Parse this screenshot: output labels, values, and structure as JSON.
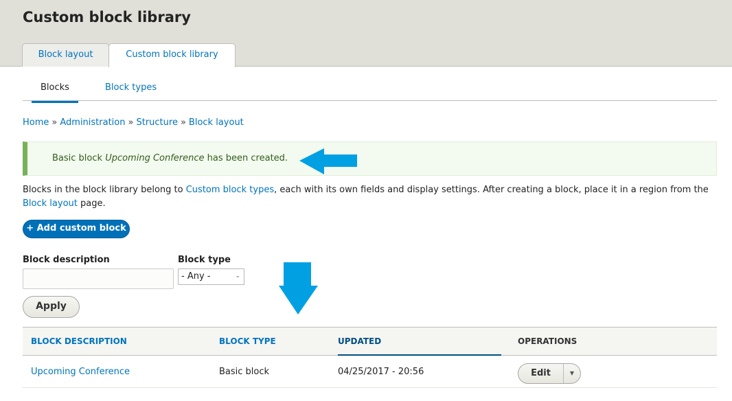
{
  "header": {
    "title": "Custom block library",
    "tabs": [
      {
        "label": "Block layout"
      },
      {
        "label": "Custom block library",
        "active": true
      }
    ]
  },
  "subtabs": [
    {
      "label": "Blocks",
      "active": true
    },
    {
      "label": "Block types"
    }
  ],
  "breadcrumb": [
    "Home",
    "Administration",
    "Structure",
    "Block layout"
  ],
  "breadcrumb_sep": "»",
  "message": {
    "prefix": "Basic block ",
    "name": "Upcoming Conference",
    "suffix": " has been created.",
    "type": "status"
  },
  "description": {
    "t1": "Blocks in the block library belong to ",
    "link1": "Custom block types",
    "t2": ", each with its own fields and display settings. After creating a block, place it in a region from the ",
    "link2": "Block layout",
    "t3": " page."
  },
  "add_button": "+ Add custom block",
  "filters": {
    "desc_label": "Block description",
    "desc_value": "",
    "type_label": "Block type",
    "type_value": "- Any -",
    "apply": "Apply"
  },
  "table": {
    "headers": [
      "BLOCK DESCRIPTION",
      "BLOCK TYPE",
      "UPDATED",
      "OPERATIONS"
    ],
    "rows": [
      {
        "description": "Upcoming Conference",
        "type": "Basic block",
        "updated": "04/25/2017 - 20:56",
        "op": "Edit"
      }
    ]
  },
  "colors": {
    "link": "#0074bd",
    "annotation_arrow": "#00a0e3",
    "status_green": "#77b259"
  }
}
